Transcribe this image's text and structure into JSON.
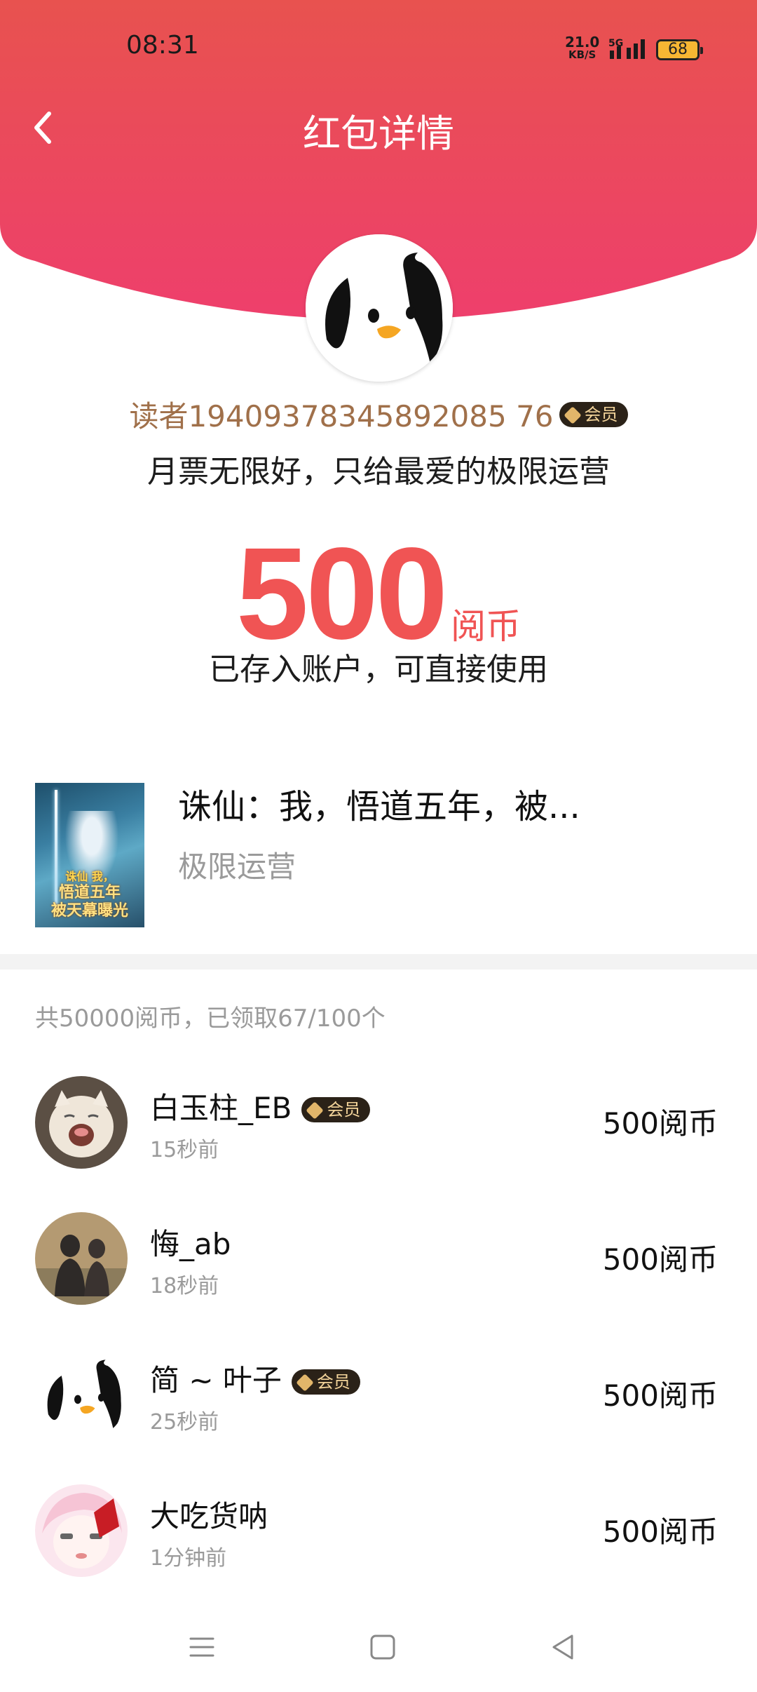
{
  "status_bar": {
    "time": "08:31",
    "net_speed": "21.0",
    "net_unit": "KB/S",
    "network": "5G",
    "battery": "68"
  },
  "header": {
    "title": "红包详情",
    "back_icon": "chevron-left-icon",
    "colors": {
      "top": "#e8524f",
      "bottom": "#ee3f6c"
    }
  },
  "sender": {
    "avatar_icon": "penguin-avatar",
    "name": "读者19409378345892085 76",
    "vip_label": "会员",
    "message": "月票无限好，只给最爱的极限运营"
  },
  "reward": {
    "amount": "500",
    "unit": "阅币",
    "note": "已存入账户，可直接使用"
  },
  "book": {
    "cover_text_top": "诛仙 我，",
    "cover_text_mid": "悟道五年",
    "cover_text_bot": "被天幕曝光",
    "title": "诛仙：我，悟道五年，被...",
    "author": "极限运营"
  },
  "summary": "共50000阅币，已领取67/100个",
  "receivers": [
    {
      "name": "白玉柱_EB",
      "vip": "会员",
      "time": "15秒前",
      "coins": "500阅币",
      "avatar": "cat-avatar"
    },
    {
      "name": "悔_ab",
      "vip": "",
      "time": "18秒前",
      "coins": "500阅币",
      "avatar": "silhouette-avatar"
    },
    {
      "name": "简 ~ 叶子",
      "vip": "会员",
      "time": "25秒前",
      "coins": "500阅币",
      "avatar": "penguin-avatar"
    },
    {
      "name": "大吃货呐",
      "vip": "",
      "time": "1分钟前",
      "coins": "500阅币",
      "avatar": "anime-avatar"
    }
  ],
  "navbar": {
    "icons": [
      "menu-icon",
      "home-square-icon",
      "back-triangle-icon"
    ]
  }
}
